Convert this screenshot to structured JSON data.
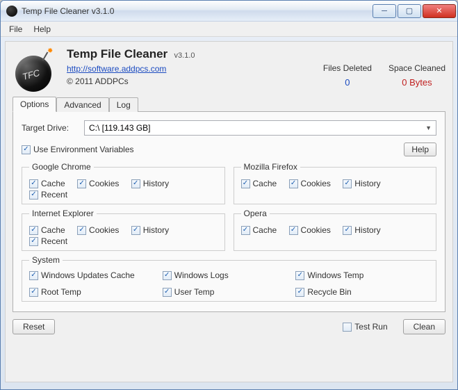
{
  "window": {
    "title": "Temp File Cleaner v3.1.0"
  },
  "menu": {
    "file": "File",
    "help": "Help"
  },
  "header": {
    "app_name": "Temp File Cleaner",
    "version": "v3.1.0",
    "link": "http://software.addpcs.com",
    "copyright": "© 2011 ADDPCs",
    "bomb_label": "TFC"
  },
  "stats": {
    "files_deleted_label": "Files Deleted",
    "files_deleted_value": "0",
    "space_cleaned_label": "Space Cleaned",
    "space_cleaned_value": "0 Bytes"
  },
  "tabs": {
    "options": "Options",
    "advanced": "Advanced",
    "log": "Log"
  },
  "options": {
    "target_drive_label": "Target Drive:",
    "target_drive_value": "C:\\ [119.143 GB]",
    "use_env_vars": "Use Environment Variables",
    "help_btn": "Help",
    "groups": {
      "chrome": {
        "title": "Google Chrome",
        "cache": "Cache",
        "cookies": "Cookies",
        "history": "History",
        "recent": "Recent"
      },
      "firefox": {
        "title": "Mozilla Firefox",
        "cache": "Cache",
        "cookies": "Cookies",
        "history": "History"
      },
      "ie": {
        "title": "Internet Explorer",
        "cache": "Cache",
        "cookies": "Cookies",
        "history": "History",
        "recent": "Recent"
      },
      "opera": {
        "title": "Opera",
        "cache": "Cache",
        "cookies": "Cookies",
        "history": "History"
      },
      "system": {
        "title": "System",
        "win_updates_cache": "Windows Updates Cache",
        "win_logs": "Windows Logs",
        "win_temp": "Windows Temp",
        "root_temp": "Root Temp",
        "user_temp": "User Temp",
        "recycle_bin": "Recycle Bin"
      }
    }
  },
  "footer": {
    "reset": "Reset",
    "test_run": "Test Run",
    "clean": "Clean"
  }
}
